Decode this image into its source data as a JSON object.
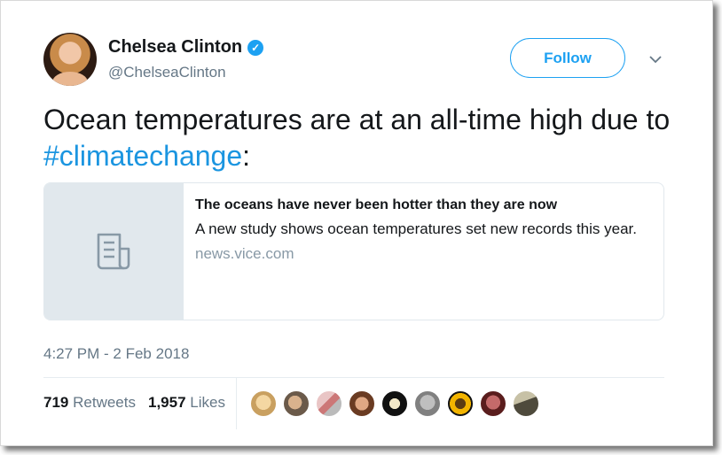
{
  "author": {
    "name": "Chelsea Clinton",
    "handle": "@ChelseaClinton",
    "verified_icon": "verified-badge-icon"
  },
  "follow_button": {
    "label": "Follow"
  },
  "tweet": {
    "text_before": "Ocean temperatures are at an all-time high due to ",
    "hashtag": "#climatechange",
    "text_after": ":"
  },
  "card": {
    "title": "The oceans have never been hotter than they are now",
    "description": "A new study shows ocean temperatures set new records this year.",
    "domain": "news.vice.com",
    "thumb_icon": "article-icon"
  },
  "timestamp": "4:27 PM - 2 Feb 2018",
  "stats": {
    "retweets_count": "719",
    "retweets_label": "Retweets",
    "likes_count": "1,957",
    "likes_label": "Likes"
  },
  "colors": {
    "accent": "#1da1f2",
    "link": "#1b95e0",
    "secondary_text": "#657786"
  }
}
